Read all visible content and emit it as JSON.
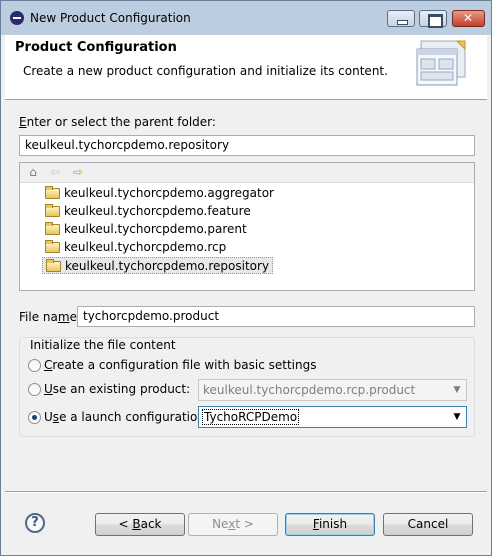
{
  "window": {
    "title": "New Product Configuration"
  },
  "banner": {
    "title": "Product Configuration",
    "description": "Create a new product configuration and initialize its content."
  },
  "parent_folder": {
    "label_mnemonic": "E",
    "label_rest": "nter or select the parent folder:",
    "value": "keulkeul.tychorcpdemo.repository"
  },
  "tree": {
    "toolbar_icons": [
      "home-icon",
      "back-arrow-icon",
      "forward-arrow-icon"
    ],
    "items": [
      {
        "label": "keulkeul.tychorcpdemo.aggregator",
        "icon": "project-folder-icon"
      },
      {
        "label": "keulkeul.tychorcpdemo.feature",
        "icon": "folder-icon"
      },
      {
        "label": "keulkeul.tychorcpdemo.parent",
        "icon": "folder-icon"
      },
      {
        "label": "keulkeul.tychorcpdemo.rcp",
        "icon": "folder-icon"
      },
      {
        "label": "keulkeul.tychorcpdemo.repository",
        "icon": "folder-icon",
        "selected": true
      }
    ]
  },
  "file_name": {
    "label_before": "File na",
    "label_mnemonic": "m",
    "label_after": "e:",
    "value": "tychorcpdemo.product"
  },
  "init_group": {
    "legend": "Initialize the file content",
    "options": [
      {
        "mnemonic": "C",
        "rest": "reate a configuration file with basic settings",
        "checked": false
      },
      {
        "mnemonic": "U",
        "rest": "se an existing product:",
        "checked": false
      },
      {
        "mnemonic": "s",
        "before": "U",
        "rest": "e a launch configuration:",
        "checked": true
      }
    ],
    "existing_product_value": "keulkeul.tychorcpdemo.rcp.product",
    "launch_config_value": "TychoRCPDemo"
  },
  "buttons": {
    "back": {
      "before": "< ",
      "mnemonic": "B",
      "after": "ack"
    },
    "next": {
      "before": "Ne",
      "mnemonic": "x",
      "after": "t >"
    },
    "finish": {
      "before": "",
      "mnemonic": "F",
      "after": "inish"
    },
    "cancel": {
      "label": "Cancel"
    }
  },
  "colors": {
    "titlebar": "#bccde0",
    "dialog_bg": "#f0f0f0",
    "focus_border": "#3c7fb1"
  }
}
